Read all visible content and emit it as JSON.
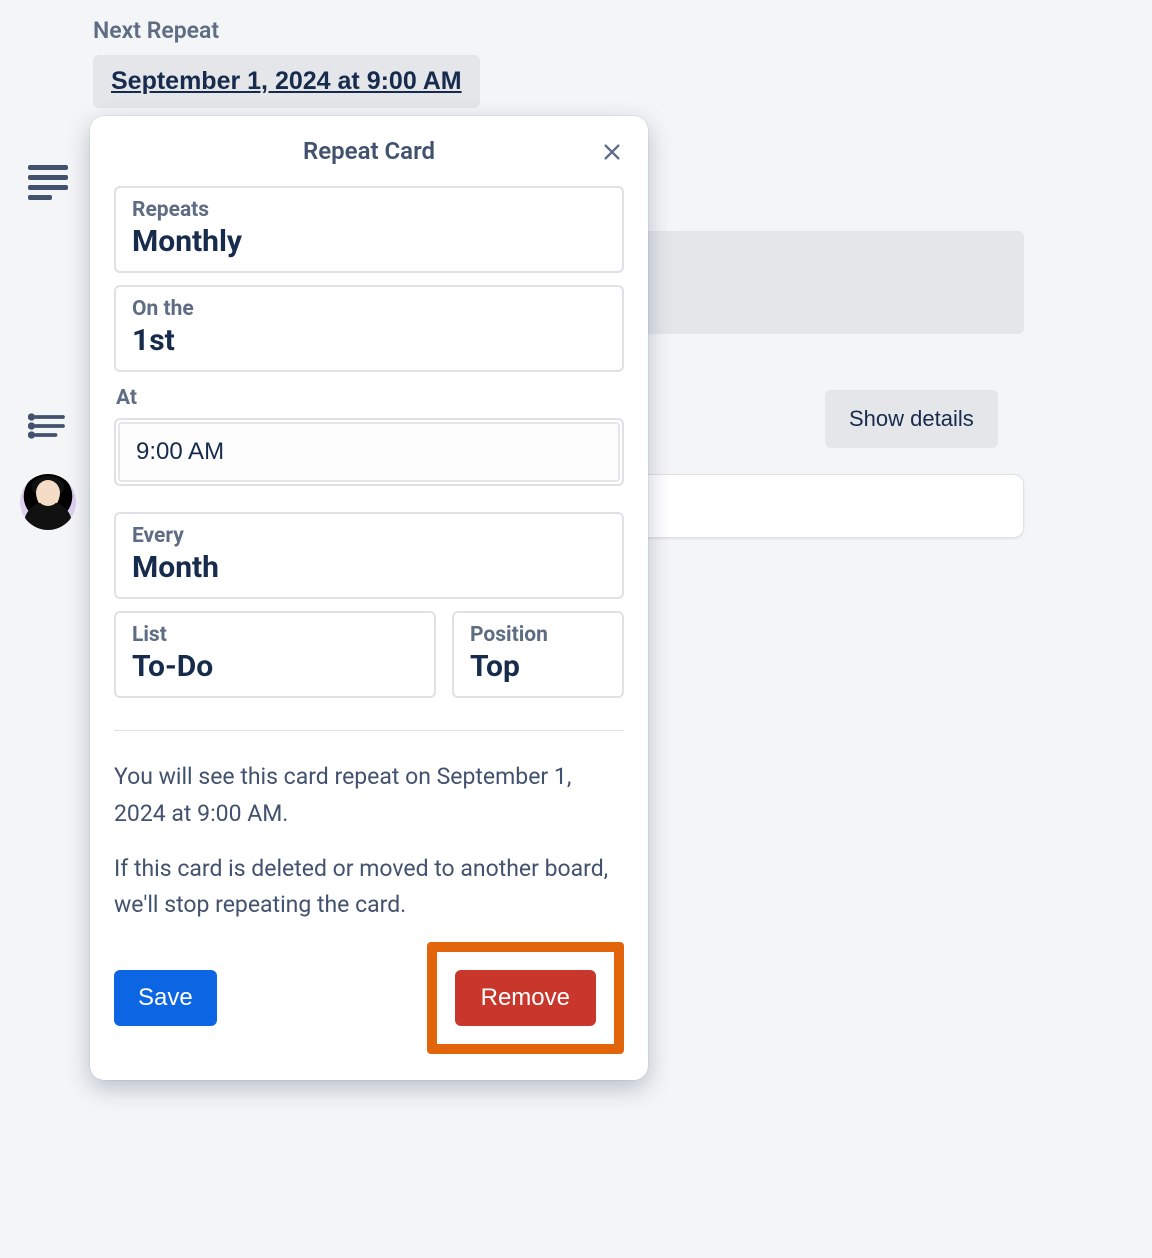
{
  "nextRepeat": {
    "label": "Next Repeat",
    "value": "September 1, 2024 at 9:00 AM"
  },
  "showDetails": "Show details",
  "popover": {
    "title": "Repeat Card",
    "repeats": {
      "label": "Repeats",
      "value": "Monthly"
    },
    "onThe": {
      "label": "On the",
      "value": "1st"
    },
    "atLabel": "At",
    "atValue": "9:00 AM",
    "every": {
      "label": "Every",
      "value": "Month"
    },
    "list": {
      "label": "List",
      "value": "To-Do"
    },
    "position": {
      "label": "Position",
      "value": "Top"
    },
    "info1": "You will see this card repeat on September 1, 2024 at 9:00 AM.",
    "info2": "If this card is deleted or moved to another board, we'll stop repeating the card.",
    "save": "Save",
    "remove": "Remove"
  }
}
